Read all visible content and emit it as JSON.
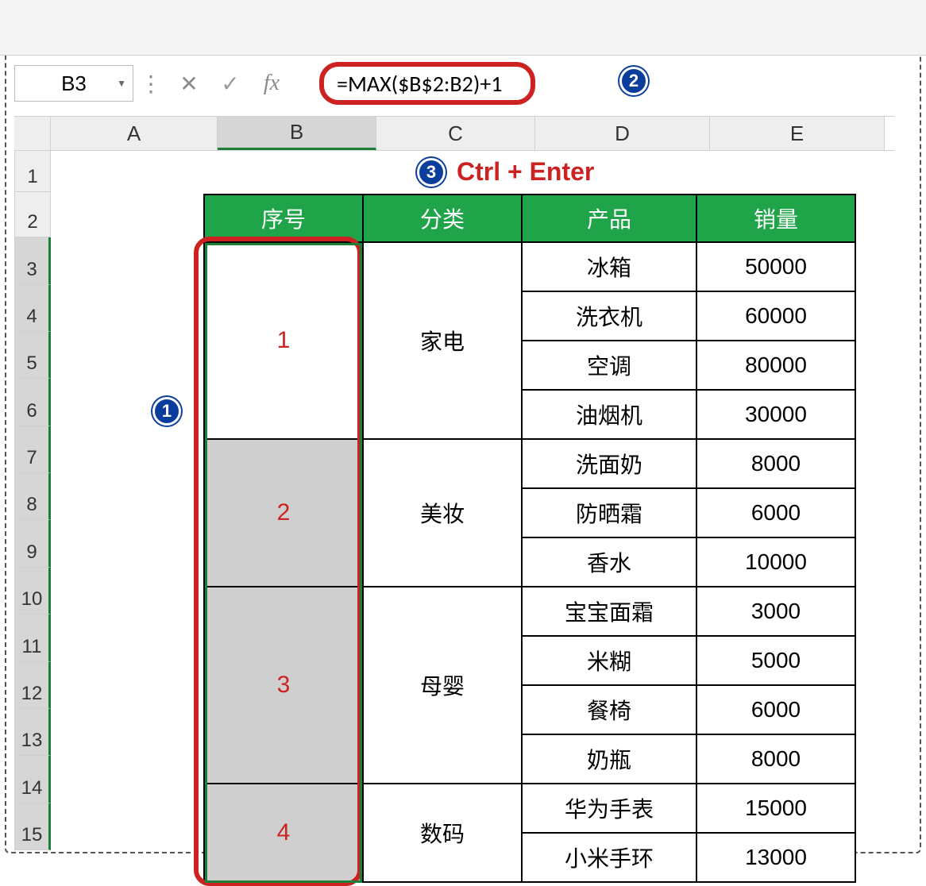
{
  "namebox": {
    "value": "B3"
  },
  "formula_bar": {
    "fx_label": "fx",
    "formula": "=MAX($B$2:B2)+1"
  },
  "shortcut_text": "Ctrl + Enter",
  "badges": {
    "b1": "1",
    "b2": "2",
    "b3": "3"
  },
  "columns": [
    "A",
    "B",
    "C",
    "D",
    "E"
  ],
  "row_numbers": [
    "1",
    "2",
    "3",
    "4",
    "5",
    "6",
    "7",
    "8",
    "9",
    "10",
    "11",
    "12",
    "13",
    "14",
    "15"
  ],
  "headers": {
    "seq": "序号",
    "cat": "分类",
    "prod": "产品",
    "sales": "销量"
  },
  "groups": [
    {
      "seq": "1",
      "category": "家电",
      "shade": false,
      "rows": [
        {
          "product": "冰箱",
          "sales": "50000"
        },
        {
          "product": "洗衣机",
          "sales": "60000"
        },
        {
          "product": "空调",
          "sales": "80000"
        },
        {
          "product": "油烟机",
          "sales": "30000"
        }
      ]
    },
    {
      "seq": "2",
      "category": "美妆",
      "shade": true,
      "rows": [
        {
          "product": "洗面奶",
          "sales": "8000"
        },
        {
          "product": "防晒霜",
          "sales": "6000"
        },
        {
          "product": "香水",
          "sales": "10000"
        }
      ]
    },
    {
      "seq": "3",
      "category": "母婴",
      "shade": true,
      "rows": [
        {
          "product": "宝宝面霜",
          "sales": "3000"
        },
        {
          "product": "米糊",
          "sales": "5000"
        },
        {
          "product": "餐椅",
          "sales": "6000"
        },
        {
          "product": "奶瓶",
          "sales": "8000"
        }
      ]
    },
    {
      "seq": "4",
      "category": "数码",
      "shade": true,
      "rows": [
        {
          "product": "华为手表",
          "sales": "15000"
        },
        {
          "product": "小米手环",
          "sales": "13000"
        }
      ]
    }
  ]
}
